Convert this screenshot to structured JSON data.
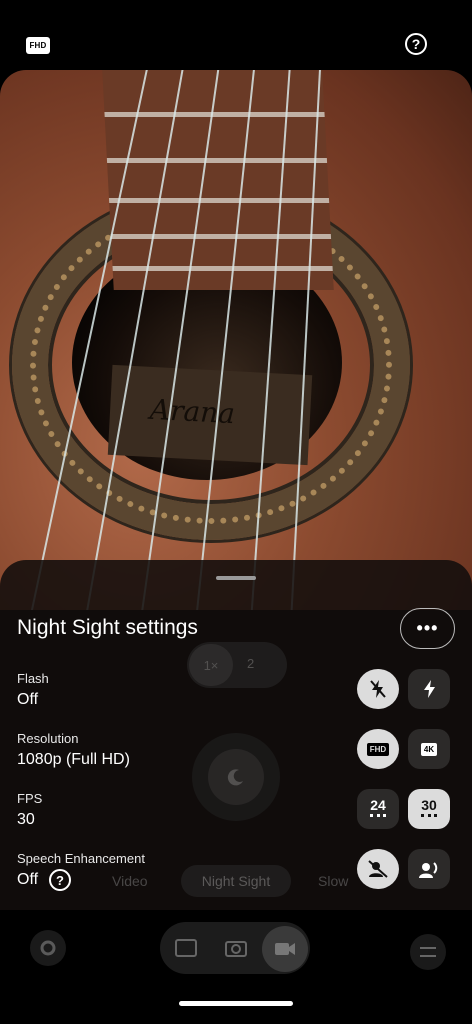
{
  "top_bar": {
    "resolution_badge": "FHD",
    "help_glyph": "?"
  },
  "viewfinder": {
    "label_text": "Arana"
  },
  "background_controls": {
    "zoom_options": [
      "1×",
      "2"
    ],
    "modes": [
      "Video",
      "Night Sight",
      "Slow"
    ]
  },
  "sheet": {
    "title": "Night Sight settings",
    "more_glyph": "•••",
    "settings": [
      {
        "label": "Flash",
        "value": "Off"
      },
      {
        "label": "Resolution",
        "value": "1080p (Full HD)"
      },
      {
        "label": "FPS",
        "value": "30"
      },
      {
        "label": "Speech Enhancement",
        "value": "Off"
      }
    ],
    "help_glyph": "?",
    "resolution_chips": [
      "FHD",
      "4K"
    ],
    "fps_options": [
      "24",
      "30"
    ]
  }
}
